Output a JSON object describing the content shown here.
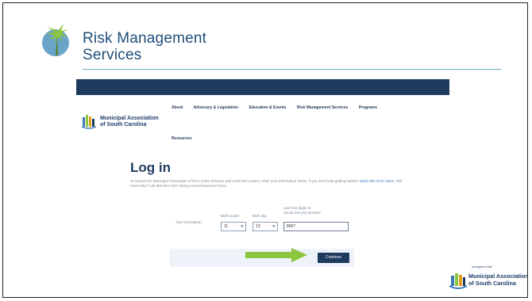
{
  "header": {
    "title_line1": "Risk Management",
    "title_line2": "Services"
  },
  "screenshot": {
    "nav_items": [
      "About",
      "Advocacy & Legislation",
      "Education & Events",
      "Risk Management Services",
      "Programs"
    ],
    "nav_item_2": "Resources",
    "org_name_line1": "Municipal Association",
    "org_name_line2": "of South Carolina",
    "login_title": "Log in",
    "login_text_1": "To access the Municipal Association of SC's online services and restricted content, enter your information below. If you need help getting started,",
    "login_link": "watch this short video",
    "login_text_2": ". Still need help? Call 803.933.1287 during normal business hours.",
    "your_information_label": "Your information:",
    "birth_month_label": "Birth month",
    "birth_day_label": "Birth day",
    "ssn_label_line1": "Last four digits of",
    "ssn_label_line2": "Social Security Number",
    "birth_month_value": "11",
    "birth_day_value": "13",
    "ssn_value": "8907",
    "continue_label": "Continue"
  },
  "footer": {
    "small_text": "a program of the",
    "org_line1": "Municipal Association",
    "org_line2": "of South Carolina"
  },
  "colors": {
    "brand_navy": "#1e3a5f",
    "arrow_green": "#8cc63f",
    "title_blue": "#1f4e79"
  }
}
